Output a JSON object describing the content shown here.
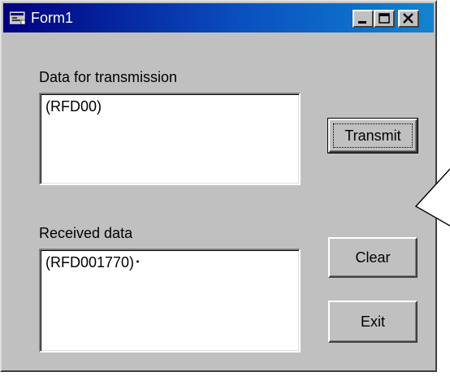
{
  "window": {
    "title": "Form1",
    "minimize_label": "_",
    "maximize_label": "□",
    "close_label": "X"
  },
  "transmit_section": {
    "label": "Data for transmission",
    "value": "(RFD00)"
  },
  "received_section": {
    "label": "Received data",
    "value": "(RFD001770)･"
  },
  "buttons": {
    "transmit": "Transmit",
    "clear": "Clear",
    "exit": "Exit"
  },
  "colors": {
    "titlebar": "#000080",
    "face": "#c0c0c0"
  }
}
